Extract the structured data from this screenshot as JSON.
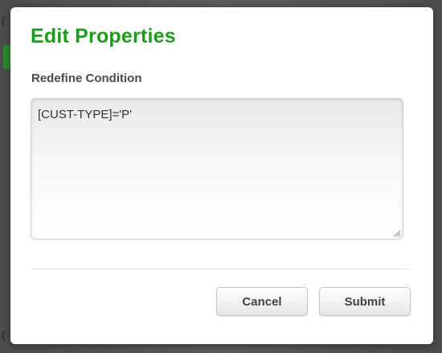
{
  "background": {
    "fragment_top": "(",
    "fragment_bottom": "("
  },
  "dialog": {
    "title": "Edit Properties",
    "field_label": "Redefine Condition",
    "condition_value": "[CUST-TYPE]='P'",
    "cancel_label": "Cancel",
    "submit_label": "Submit",
    "title_color": "#1f9a1f"
  }
}
